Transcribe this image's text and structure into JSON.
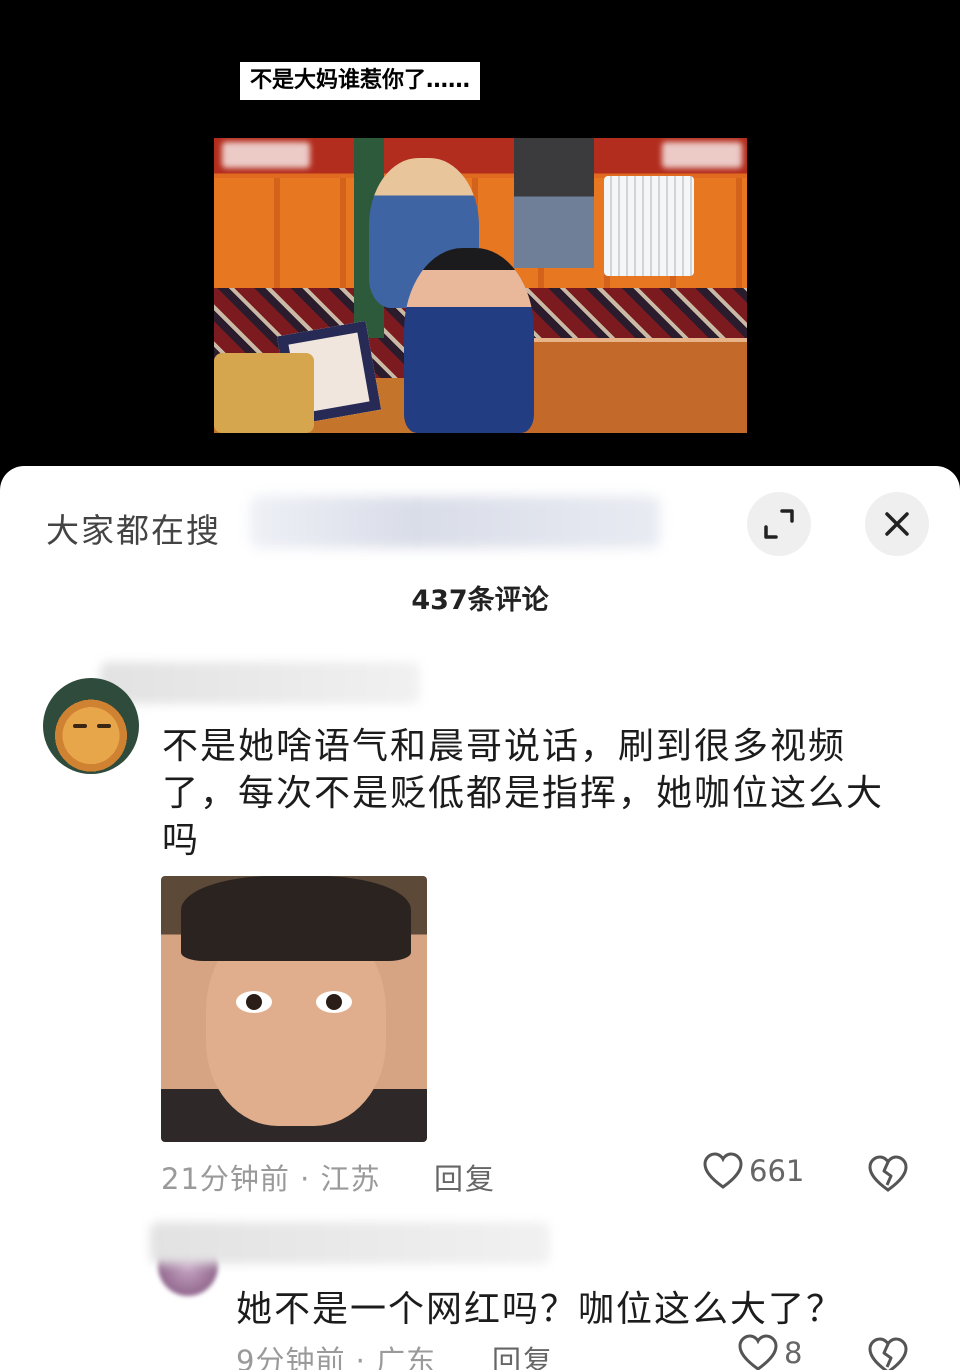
{
  "video": {
    "caption": "不是大妈谁惹你了……"
  },
  "sheet": {
    "search_hint": "大家都在搜",
    "comment_count_title": "437条评论"
  },
  "comments": [
    {
      "text": "不是她啥语气和晨哥说话，刷到很多视频了，每次不是贬低都是指挥，她咖位这么大吗",
      "time_location": "21分钟前 · 江苏",
      "reply_label": "回复",
      "likes": "661"
    },
    {
      "text": "她不是一个网红吗？咖位这么大了？",
      "time_location": "9分钟前 · 广东",
      "reply_label": "回复",
      "likes": "8"
    }
  ],
  "icons": {
    "expand": "expand-icon",
    "close": "close-icon",
    "like": "heart-icon",
    "dislike": "broken-heart-icon"
  }
}
